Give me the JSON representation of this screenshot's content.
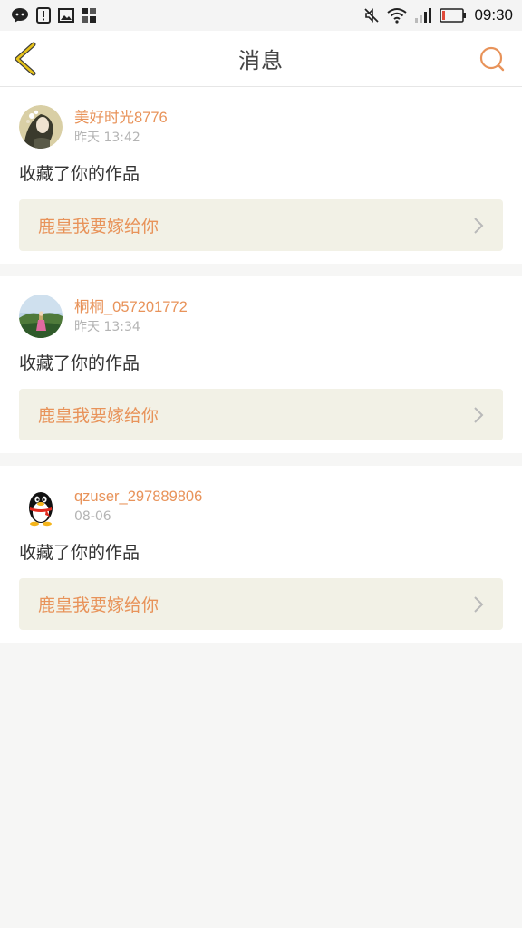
{
  "status_bar": {
    "time": "09:30",
    "left_icons": [
      "chat-app-icon",
      "alert-icon",
      "image-icon",
      "apps-icon"
    ],
    "right_icons": [
      "mute-icon",
      "wifi-icon",
      "signal-icon",
      "battery-icon"
    ]
  },
  "header": {
    "title": "消息"
  },
  "colors": {
    "accent": "#e8935a",
    "back_arrow": "#e6c21a",
    "link_bg": "#f2f1e6",
    "page_bg": "#f6f6f5"
  },
  "messages": [
    {
      "username": "美好时光8776",
      "time": "昨天 13:42",
      "action": "收藏了你的作品",
      "work_title": "鹿皇我要嫁给你"
    },
    {
      "username": "桐桐_057201772",
      "time": "昨天 13:34",
      "action": "收藏了你的作品",
      "work_title": "鹿皇我要嫁给你"
    },
    {
      "username": "qzuser_297889806",
      "time": "08-06",
      "action": "收藏了你的作品",
      "work_title": "鹿皇我要嫁给你"
    }
  ]
}
